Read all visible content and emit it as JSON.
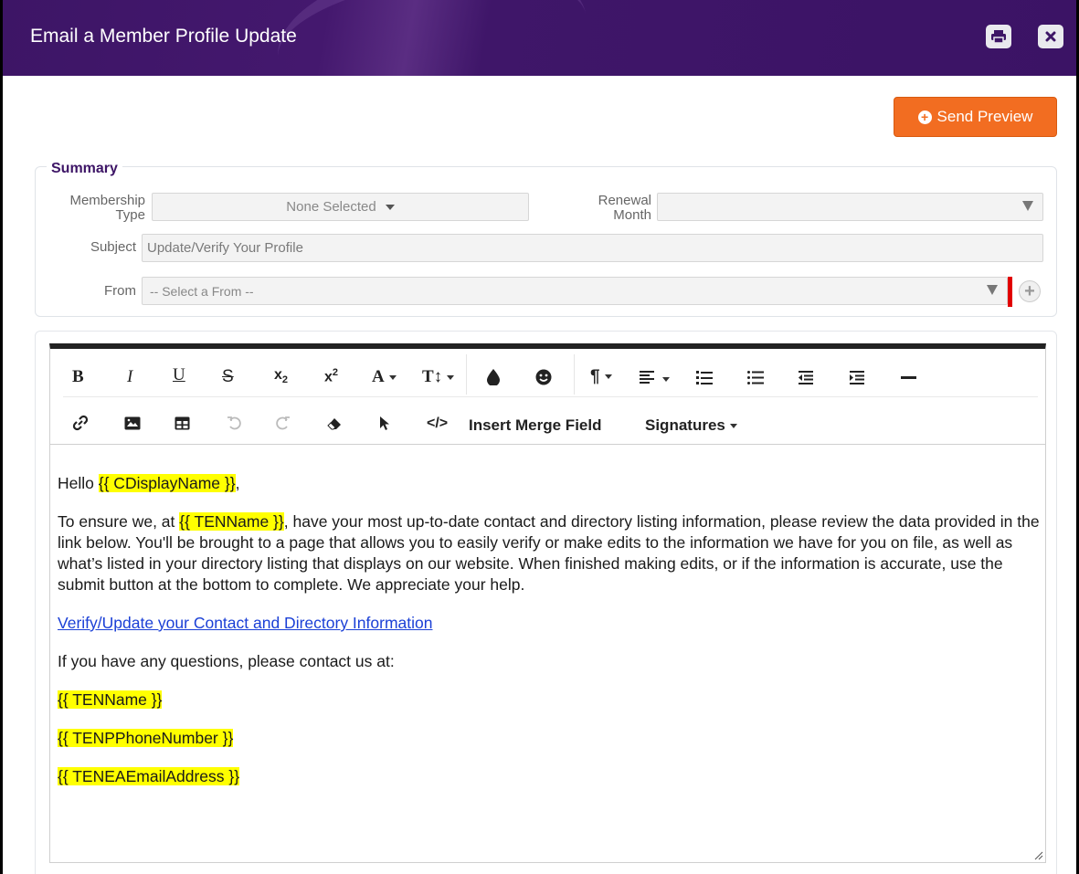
{
  "window": {
    "title": "Email a Member Profile Update",
    "print_icon": "print-icon",
    "close_icon": "close-icon"
  },
  "actions": {
    "send_preview": "Send Preview"
  },
  "summary": {
    "legend": "Summary",
    "membership_type": {
      "label_line1": "Membership",
      "label_line2": "Type",
      "value": "None Selected"
    },
    "renewal_month": {
      "label_line1": "Renewal",
      "label_line2": "Month",
      "value": ""
    },
    "subject": {
      "label": "Subject",
      "value": "Update/Verify Your Profile"
    },
    "from": {
      "label": "From",
      "value": "-- Select a From --"
    }
  },
  "toolbar": {
    "row1": [
      {
        "name": "bold",
        "glyph": "B"
      },
      {
        "name": "italic",
        "glyph": "I"
      },
      {
        "name": "underline",
        "glyph": "U"
      },
      {
        "name": "strikethrough",
        "glyph": "S"
      },
      {
        "name": "subscript",
        "glyph": "x₂"
      },
      {
        "name": "superscript",
        "glyph": "x²"
      },
      {
        "name": "font-family",
        "glyph": "A"
      },
      {
        "name": "font-size",
        "glyph": "TI"
      }
    ],
    "insert_merge_field": "Insert Merge Field",
    "signatures": "Signatures"
  },
  "body": {
    "greeting_prefix": "Hello ",
    "greeting_field": "{{ CDisplayName }}",
    "greeting_suffix": ",",
    "para1_prefix": "To ensure we, at ",
    "para1_field": "{{ TENName }}",
    "para1_rest": ", have your most up-to-date contact and directory listing information, please review the data provided in the link below. You'll be brought to a page that allows you to easily verify or make edits to the information we have for you on file, as well as what’s listed in your directory listing that displays on our website. When finished making edits, or if the information is accurate, use the submit button at the bottom to complete. We appreciate your help.",
    "link": "Verify/Update your Contact and Directory Information",
    "contact_line": "If you have any questions, please contact us at:",
    "field1": "{{ TENName }}",
    "field2": "{{ TENPPhoneNumber }}",
    "field3": "{{ TENEAEmailAddress }}"
  },
  "colors": {
    "header": "#3d1566",
    "accent": "#f26d21",
    "highlight": "#ffff00",
    "link": "#1a3fd6"
  }
}
